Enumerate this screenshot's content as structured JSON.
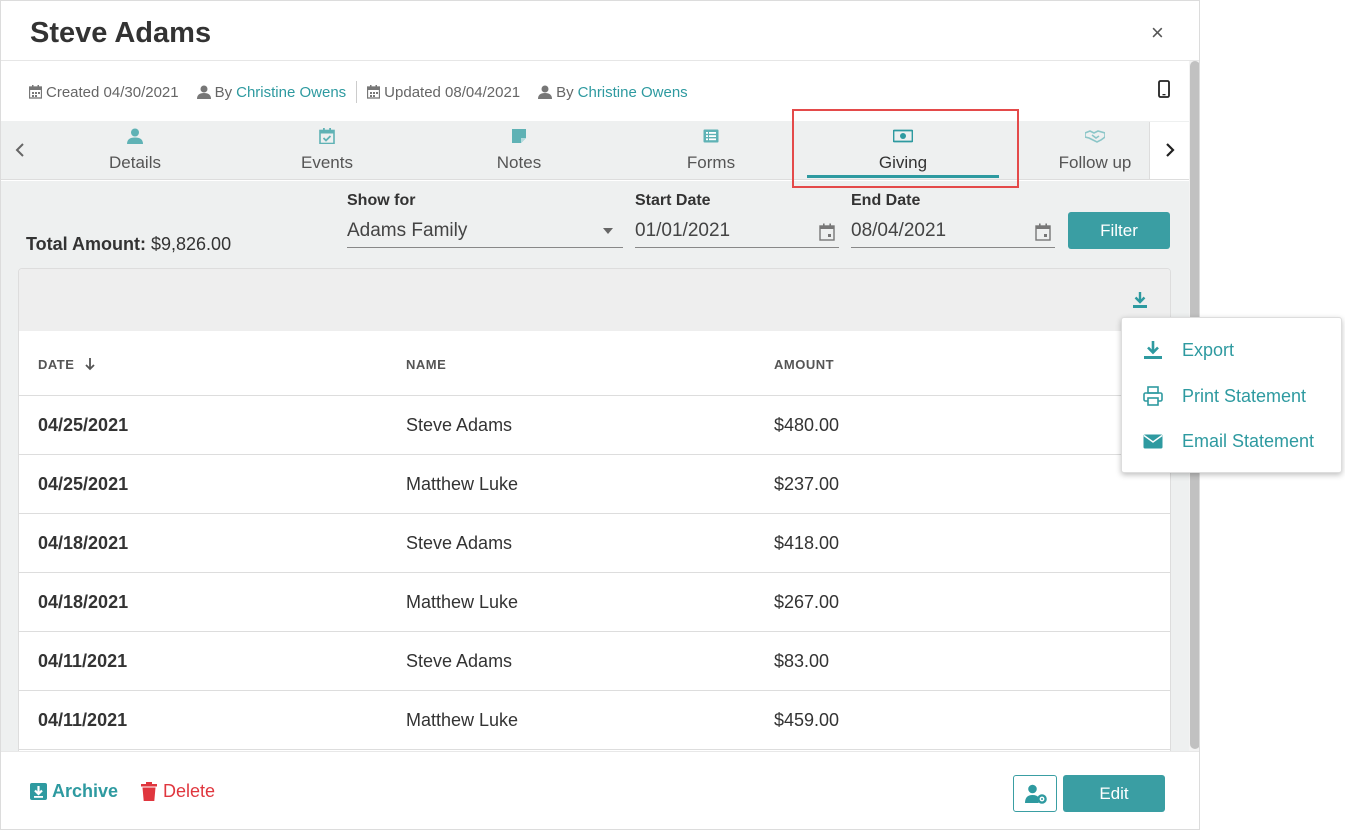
{
  "modal": {
    "title": "Steve Adams",
    "close_label": "×"
  },
  "meta": {
    "created": "Created 04/30/2021",
    "created_by_prefix": "By",
    "created_by": "Christine Owens",
    "updated": "Updated 08/04/2021",
    "updated_by_prefix": "By",
    "updated_by": "Christine Owens"
  },
  "tabs": [
    {
      "label": "Details",
      "icon": "user-icon"
    },
    {
      "label": "Events",
      "icon": "calendar-check-icon"
    },
    {
      "label": "Notes",
      "icon": "sticky-note-icon"
    },
    {
      "label": "Forms",
      "icon": "list-icon"
    },
    {
      "label": "Giving",
      "icon": "money-bill-icon",
      "active": true
    },
    {
      "label": "Follow up",
      "icon": "handshake-icon"
    }
  ],
  "filters": {
    "total_label": "Total Amount:",
    "total_value": "$9,826.00",
    "show_for_label": "Show for",
    "show_for_value": "Adams Family",
    "start_label": "Start Date",
    "start_value": "01/01/2021",
    "end_label": "End Date",
    "end_value": "08/04/2021",
    "filter_button": "Filter"
  },
  "table": {
    "columns": [
      "DATE",
      "NAME",
      "AMOUNT"
    ],
    "rows": [
      {
        "date": "04/25/2021",
        "name": "Steve Adams",
        "amount": "$480.00"
      },
      {
        "date": "04/25/2021",
        "name": "Matthew Luke",
        "amount": "$237.00"
      },
      {
        "date": "04/18/2021",
        "name": "Steve Adams",
        "amount": "$418.00"
      },
      {
        "date": "04/18/2021",
        "name": "Matthew Luke",
        "amount": "$267.00"
      },
      {
        "date": "04/11/2021",
        "name": "Steve Adams",
        "amount": "$83.00"
      },
      {
        "date": "04/11/2021",
        "name": "Matthew Luke",
        "amount": "$459.00"
      }
    ]
  },
  "menu": {
    "items": [
      {
        "label": "Export",
        "icon": "download-icon"
      },
      {
        "label": "Print Statement",
        "icon": "printer-icon"
      },
      {
        "label": "Email Statement",
        "icon": "envelope-icon"
      }
    ]
  },
  "footer": {
    "archive_label": "Archive",
    "delete_label": "Delete",
    "edit_label": "Edit"
  },
  "colors": {
    "accent": "#3a9ea3",
    "link": "#2e9aa0",
    "danger": "#e0363e",
    "highlight": "#e44a4a"
  }
}
